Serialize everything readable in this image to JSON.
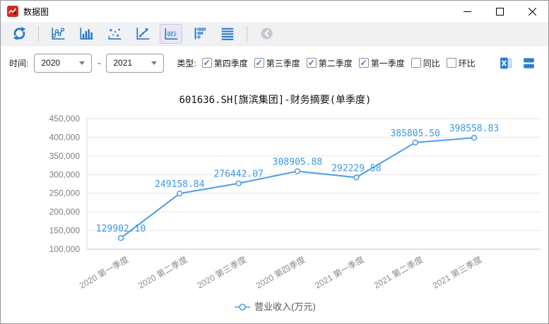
{
  "window": {
    "title": "数据图"
  },
  "toolbar": {
    "icons": [
      "refresh-icon",
      "line-chart-icon",
      "bar-chart-icon",
      "scatter-chart-icon",
      "trend-chart-icon",
      "data-label-chart-icon",
      "value-axis-icon",
      "grid-lines-icon",
      "back-icon"
    ],
    "selected_icon": "data-label-chart-icon"
  },
  "filters": {
    "time_label": "时间:",
    "time_from": "2020",
    "time_to": "2021",
    "range_separator": "-",
    "type_label": "类型:",
    "checkboxes": [
      {
        "name": "q4",
        "label": "第四季度",
        "checked": true
      },
      {
        "name": "q3",
        "label": "第三季度",
        "checked": true
      },
      {
        "name": "q2",
        "label": "第二季度",
        "checked": true
      },
      {
        "name": "q1",
        "label": "第一季度",
        "checked": true
      },
      {
        "name": "yoy",
        "label": "同比",
        "checked": false
      },
      {
        "name": "mom",
        "label": "环比",
        "checked": false
      }
    ],
    "export_icons": [
      "excel-export-icon",
      "save-icon"
    ]
  },
  "chart_data": {
    "type": "line",
    "title": "601636.SH[旗滨集团]-财务摘要(单季度)",
    "categories": [
      "2020 第一季度",
      "2020 第二季度",
      "2020 第三季度",
      "2020 第四季度",
      "2021 第一季度",
      "2021 第二季度",
      "2021 第三季度"
    ],
    "series": [
      {
        "name": "营业收入(万元)",
        "values": [
          129902.1,
          249158.84,
          276442.07,
          308905.88,
          292229.58,
          385805.5,
          398558.83
        ]
      }
    ],
    "data_labels": [
      "129902.10",
      "249158.84",
      "276442.07",
      "308905.88",
      "292229.58",
      "385805.50",
      "398558.83"
    ],
    "ylim": [
      100000,
      450000
    ],
    "ytick_step": 50000,
    "ytick_labels": [
      "100,000",
      "150,000",
      "200,000",
      "250,000",
      "300,000",
      "350,000",
      "400,000",
      "450,000"
    ],
    "xlabel": "",
    "ylabel": "",
    "legend": [
      "营业收入(万元)"
    ],
    "legend_position": "bottom",
    "grid": true,
    "x_label_rotation": 30,
    "colors": {
      "line": "#4d9de9",
      "data_label": "#3d96e8",
      "axis_text": "#8c8c8c",
      "grid_line": "#e6e6e6",
      "axis_line": "#c9c9c9"
    }
  }
}
